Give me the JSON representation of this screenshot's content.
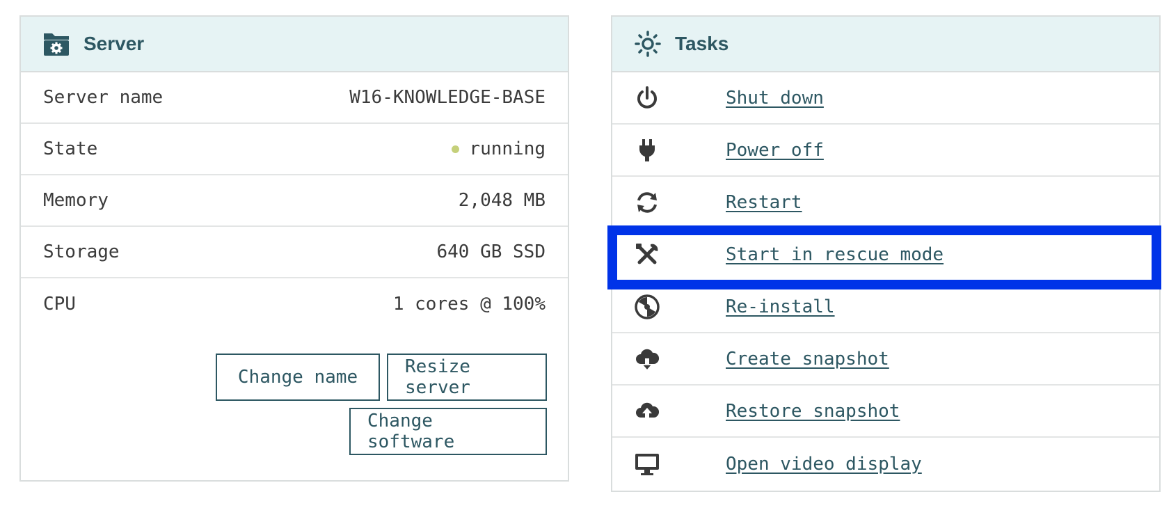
{
  "server_panel": {
    "title": "Server",
    "icon": "folder-gear-icon",
    "rows": [
      {
        "label": "Server name",
        "value": "W16-KNOWLEDGE-BASE"
      },
      {
        "label": "State",
        "value": "running"
      },
      {
        "label": "Memory",
        "value": "2,048 MB"
      },
      {
        "label": "Storage",
        "value": "640 GB SSD"
      },
      {
        "label": "CPU",
        "value": "1 cores @ 100%"
      }
    ],
    "state_color": "#c5d07a",
    "buttons": {
      "change_name": "Change name",
      "resize_server": "Resize server",
      "change_software": "Change software"
    }
  },
  "tasks_panel": {
    "title": "Tasks",
    "icon": "sun-gear-icon",
    "items": [
      {
        "label": "Shut down",
        "icon": "power-icon"
      },
      {
        "label": "Power off",
        "icon": "plug-icon"
      },
      {
        "label": "Restart",
        "icon": "refresh-icon"
      },
      {
        "label": "Start in rescue mode",
        "icon": "tools-icon",
        "highlighted": true
      },
      {
        "label": "Re-install",
        "icon": "disc-icon"
      },
      {
        "label": "Create snapshot",
        "icon": "cloud-download-icon"
      },
      {
        "label": "Restore snapshot",
        "icon": "cloud-upload-icon"
      },
      {
        "label": "Open video display",
        "icon": "monitor-icon"
      }
    ]
  },
  "colors": {
    "accent": "#2d5762",
    "header_bg": "#e6f3f4",
    "highlight": "#0033e8"
  }
}
